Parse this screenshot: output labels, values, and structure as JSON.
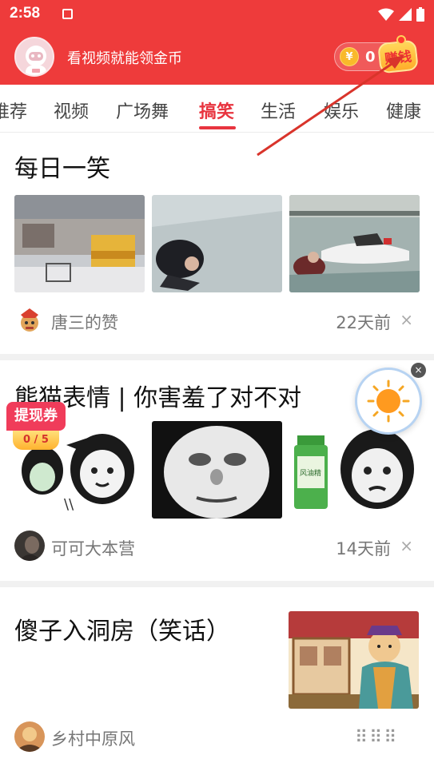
{
  "status_bar": {
    "time": "2:58"
  },
  "header": {
    "promo_text": "看视频就能领金币",
    "coin_count": "0",
    "coin_symbol": "¥",
    "earn_label": "赚钱"
  },
  "tabs": [
    {
      "label": "推荐"
    },
    {
      "label": "视频"
    },
    {
      "label": "广场舞"
    },
    {
      "label": "搞笑",
      "active": true
    },
    {
      "label": "生活"
    },
    {
      "label": "娱乐"
    },
    {
      "label": "健康"
    }
  ],
  "feed": [
    {
      "title": "每日一笑",
      "author": "唐三的赞",
      "time": "22天前",
      "close": "×"
    },
    {
      "title": "熊猫表情 | 你害羞了对不对",
      "author": "可可大本营",
      "time": "14天前",
      "close": "×"
    },
    {
      "title": "傻子入洞房（笑话）",
      "author": "乡村中原风",
      "time": "",
      "close": ""
    }
  ],
  "coupon": {
    "label": "提现券",
    "progress": "0 / 5"
  },
  "floating": {
    "close": "×"
  },
  "colors": {
    "brand_red": "#ee3b3b",
    "active_tab": "#e8343f"
  }
}
